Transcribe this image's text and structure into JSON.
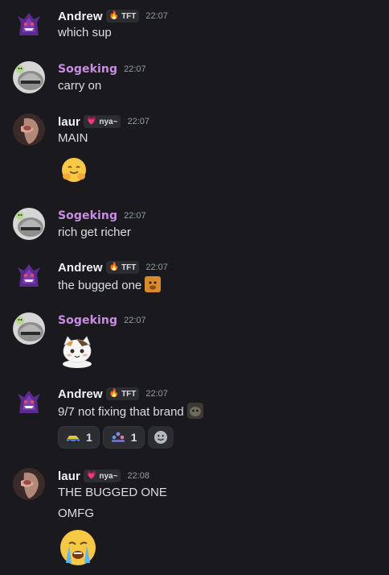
{
  "tags": {
    "tft": {
      "label": "TFT",
      "icon": "fire-icon"
    },
    "nya": {
      "label": "nya~",
      "icon": "heart-icon"
    }
  },
  "messages": [
    {
      "author": "Andrew",
      "tag": "TFT",
      "time": "22:07",
      "lines": [
        "which sup"
      ]
    },
    {
      "author": "Sogeking",
      "time": "22:07",
      "lines": [
        "carry on"
      ]
    },
    {
      "author": "laur",
      "tag": "nya~",
      "time": "22:07",
      "lines": [
        "MAIN"
      ],
      "emoji": "hugging-face-emoji"
    },
    {
      "author": "Sogeking",
      "time": "22:07",
      "lines": [
        "rich get richer"
      ]
    },
    {
      "author": "Andrew",
      "tag": "TFT",
      "time": "22:07",
      "lines": [
        "the bugged one"
      ],
      "inline_emoji": "doge-emoji"
    },
    {
      "author": "Sogeking",
      "time": "22:07",
      "sticker": "cat-sticker"
    },
    {
      "author": "Andrew",
      "tag": "TFT",
      "time": "22:07",
      "lines": [
        "9/7 not fixing that brand"
      ],
      "inline_emoji": "monkey-emoji",
      "reactions": [
        {
          "emoji": "car-emoji",
          "count": "1"
        },
        {
          "emoji": "people-emoji",
          "count": "1"
        }
      ]
    },
    {
      "author": "laur",
      "tag": "nya~",
      "time": "22:08",
      "lines": [
        "THE BUGGED ONE",
        "OMFG"
      ],
      "emoji": "crying-face-emoji"
    }
  ],
  "colors": {
    "background": "#1a1a1e",
    "sogeking": "#c98de3",
    "timestamp": "#949ba4"
  }
}
